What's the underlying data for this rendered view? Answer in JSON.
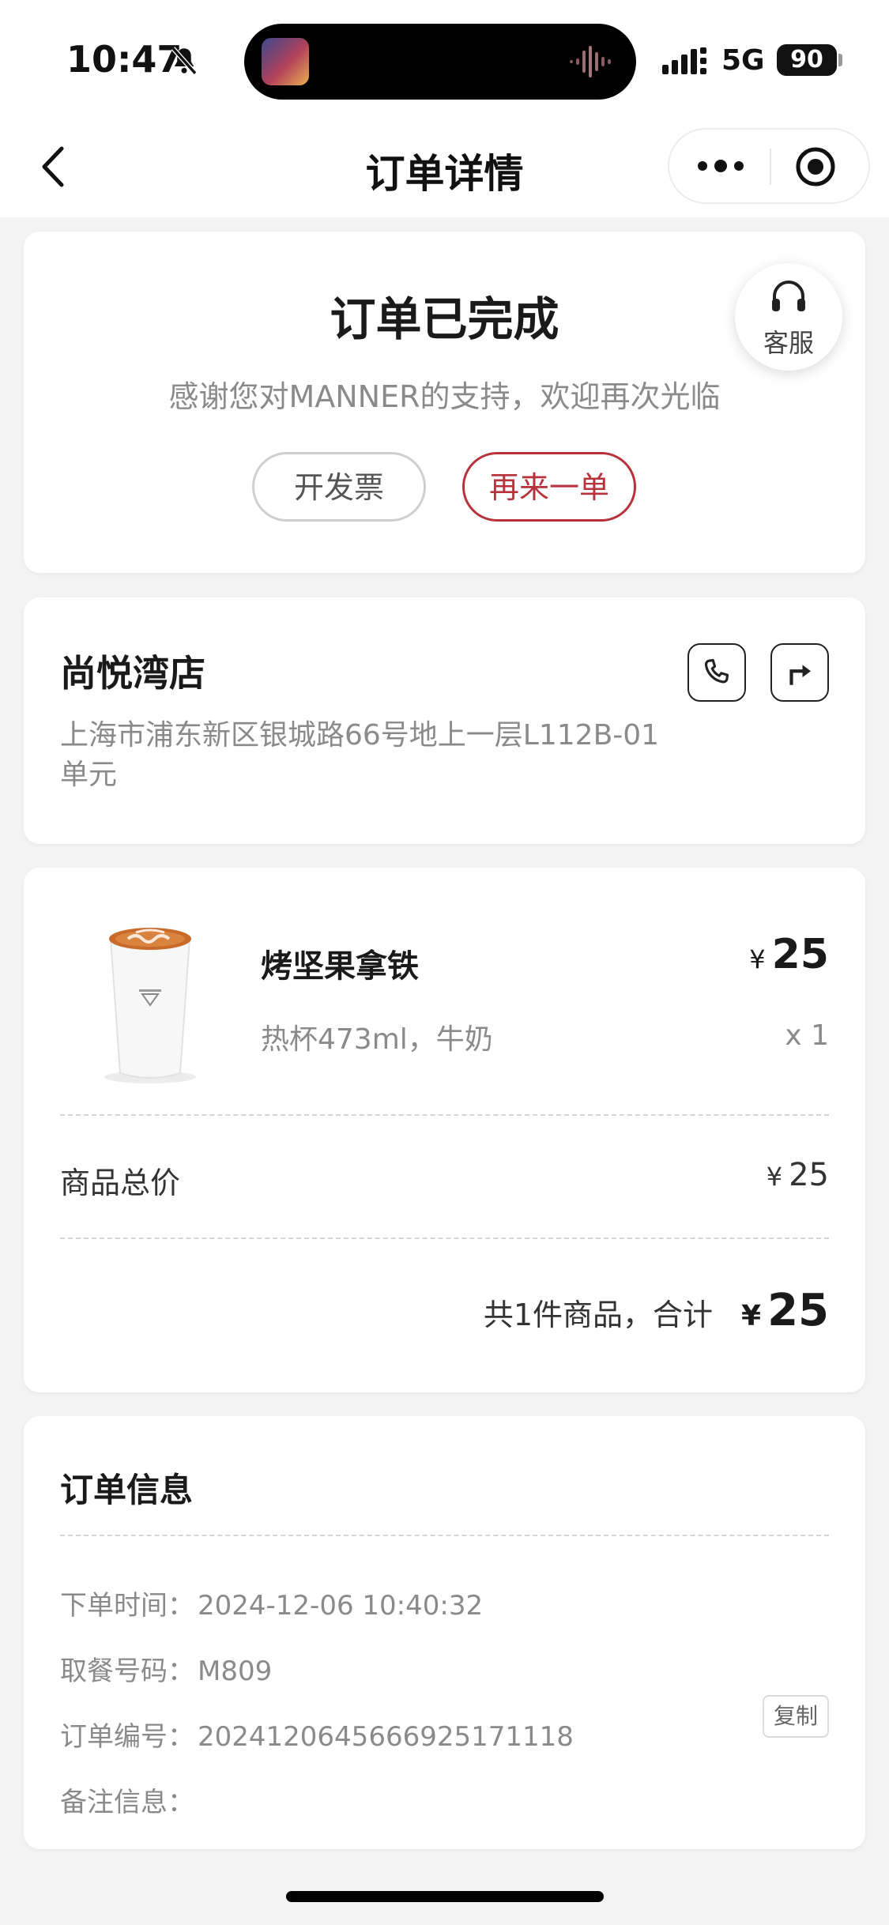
{
  "status_bar": {
    "time": "10:47",
    "network": "5G",
    "battery": "90"
  },
  "nav": {
    "title": "订单详情"
  },
  "order_status": {
    "title": "订单已完成",
    "subtitle": "感谢您对MANNER的支持，欢迎再次光临",
    "invoice_label": "开发票",
    "reorder_label": "再来一单",
    "service_label": "客服",
    "accent_color": "#b8323c"
  },
  "store": {
    "name": "尚悦湾店",
    "address": "上海市浦东新区银城路66号地上一层L112B-01单元"
  },
  "product": {
    "name": "烤坚果拿铁",
    "options": "热杯473ml，牛奶",
    "currency": "¥",
    "price": "25",
    "quantity": "x 1"
  },
  "summary": {
    "subtotal_label": "商品总价",
    "subtotal_currency": "¥",
    "subtotal_value": "25",
    "total_label": "共1件商品，合计",
    "total_currency": "¥",
    "total_value": "25"
  },
  "order_info": {
    "title": "订单信息",
    "time_label": "下单时间：",
    "time_value": "2024-12-06 10:40:32",
    "pickup_label": "取餐号码：",
    "pickup_value": "M809",
    "orderno_label": "订单编号：",
    "orderno_value": "2024120645666925171118",
    "copy_label": "复制",
    "remark_label": "备注信息：",
    "remark_value": ""
  },
  "icons": {
    "back": "chevron-left-icon",
    "more": "more-dots-icon",
    "close": "target-icon",
    "service": "headset-icon",
    "phone": "phone-icon",
    "directions": "directions-icon"
  }
}
